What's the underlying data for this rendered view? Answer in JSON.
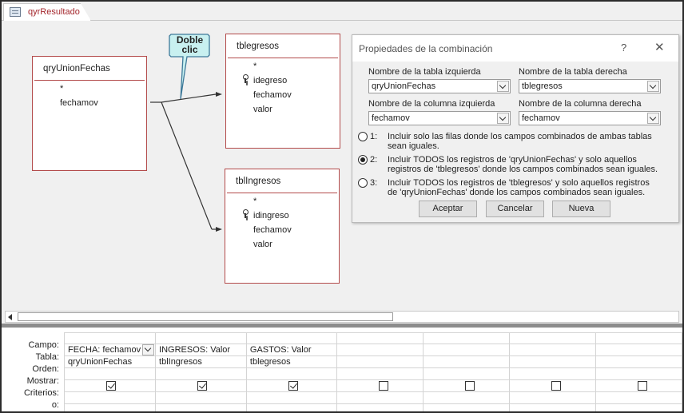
{
  "tab": {
    "title": "qyrResultado"
  },
  "tables": {
    "left": {
      "name": "qryUnionFechas",
      "fields": [
        "*",
        "fechamov"
      ]
    },
    "right1": {
      "name": "tblegresos",
      "fields": [
        "*",
        "idegreso",
        "fechamov",
        "valor"
      ]
    },
    "right2": {
      "name": "tblIngresos",
      "fields": [
        "*",
        "idingreso",
        "fechamov",
        "valor"
      ]
    }
  },
  "callout": {
    "line1": "Doble",
    "line2": "clic"
  },
  "dialog": {
    "title": "Propiedades de la combinación",
    "help": "?",
    "close": "✕",
    "left_table_label": "Nombre de la tabla izquierda",
    "right_table_label": "Nombre de la tabla derecha",
    "left_table_value": "qryUnionFechas",
    "right_table_value": "tblegresos",
    "left_col_label": "Nombre de la columna izquierda",
    "right_col_label": "Nombre de la columna derecha",
    "left_col_value": "fechamov",
    "right_col_value": "fechamov",
    "options": [
      {
        "num": "1:",
        "line1": "Incluir solo las filas donde los campos combinados de ambas tablas",
        "line2": "sean iguales.",
        "selected": false
      },
      {
        "num": "2:",
        "line1": "Incluir TODOS los registros de 'qryUnionFechas' y solo aquellos",
        "line2": "registros de 'tblegresos' donde los campos combinados sean iguales.",
        "selected": true
      },
      {
        "num": "3:",
        "line1": "Incluir TODOS los registros de 'tblegresos' y solo aquellos registros",
        "line2": "de 'qryUnionFechas' donde los campos combinados sean iguales.",
        "selected": false
      }
    ],
    "accept": "Aceptar",
    "cancel": "Cancelar",
    "new": "Nueva"
  },
  "grid": {
    "row_labels": [
      "Campo:",
      "Tabla:",
      "Orden:",
      "Mostrar:",
      "Criterios:",
      "o:"
    ],
    "columns": [
      {
        "campo": "FECHA: fechamov",
        "tabla": "qryUnionFechas",
        "mostrar": true
      },
      {
        "campo": "INGRESOS: Valor",
        "tabla": "tblIngresos",
        "mostrar": true
      },
      {
        "campo": "GASTOS: Valor",
        "tabla": "tblegresos",
        "mostrar": true
      },
      {
        "campo": "",
        "tabla": "",
        "mostrar": false
      },
      {
        "campo": "",
        "tabla": "",
        "mostrar": false
      },
      {
        "campo": "",
        "tabla": "",
        "mostrar": false
      },
      {
        "campo": "",
        "tabla": "",
        "mostrar": false
      }
    ]
  }
}
